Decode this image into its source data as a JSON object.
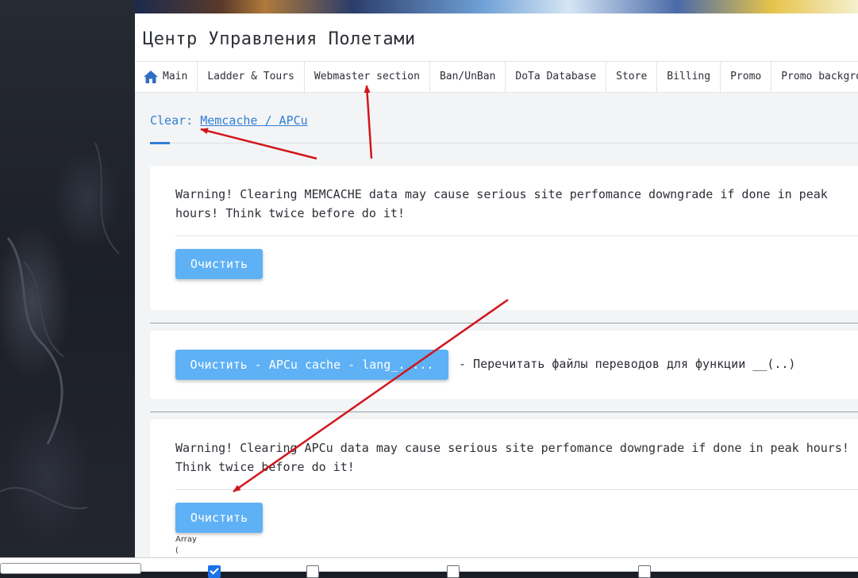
{
  "header": {
    "title": "Центр Управления Полетами"
  },
  "nav": {
    "items": [
      {
        "label": "Main",
        "icon": "home-icon"
      },
      {
        "label": "Ladder & Tours"
      },
      {
        "label": "Webmaster section"
      },
      {
        "label": "Ban/UnBan"
      },
      {
        "label": "DoTa Database"
      },
      {
        "label": "Store"
      },
      {
        "label": "Billing"
      },
      {
        "label": "Promo"
      },
      {
        "label": "Promo backgro"
      }
    ]
  },
  "tab": {
    "prefix": "Clear: ",
    "link": "Memcache / APCu"
  },
  "memcache": {
    "warning": "Warning! Clearing MEMCACHE data may cause serious site perfomance downgrade if done in peak hours! Think twice before do it!",
    "button": "Очистить"
  },
  "lang": {
    "button": "Очистить - APCu cache - lang_. ...",
    "description": "- Перечитать файлы переводов для функции __(..)"
  },
  "apcu": {
    "warning": "Warning! Clearing APCu data may cause serious site perfomance downgrade if done in peak hours! Think twice before do it!",
    "button": "Очистить",
    "output_line1": "Array",
    "output_line2": "("
  },
  "colors": {
    "accent": "#2f7fd6",
    "button": "#5eb1f5",
    "annotation_arrow": "#d0161b"
  }
}
